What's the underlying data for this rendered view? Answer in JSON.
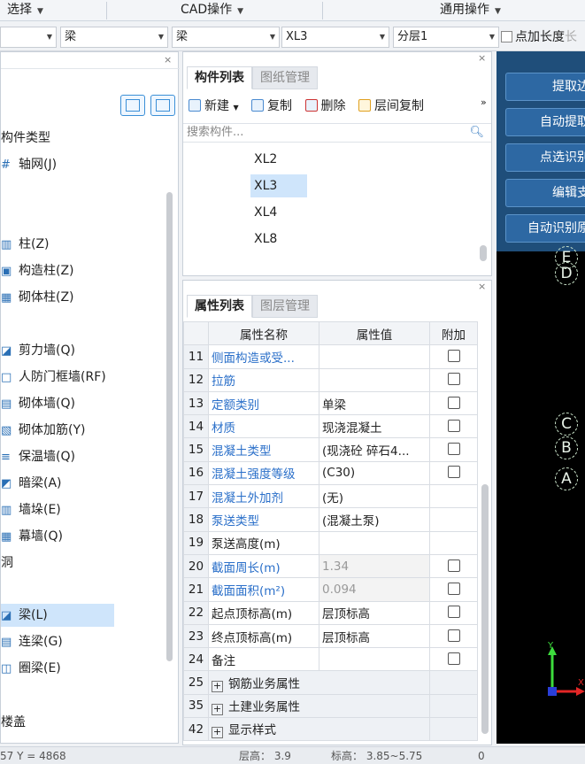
{
  "menu": {
    "items": [
      "选择",
      "CAD操作",
      "通用操作"
    ]
  },
  "combos": {
    "c1": "",
    "c2": "梁",
    "c3": "梁",
    "c4": "XL3",
    "c5": "分层1"
  },
  "checkbox": {
    "label": "点加长度",
    "faded": "长"
  },
  "left": {
    "section_title": "构件类型",
    "items": [
      {
        "icon": "#",
        "label": "轴网(J)"
      },
      {
        "icon": "▥",
        "label": "柱(Z)"
      },
      {
        "icon": "▣",
        "label": "构造柱(Z)"
      },
      {
        "icon": "▦",
        "label": "砌体柱(Z)"
      },
      {
        "icon": "◪",
        "label": "剪力墙(Q)"
      },
      {
        "icon": "□",
        "label": "人防门框墙(RF)"
      },
      {
        "icon": "▤",
        "label": "砌体墙(Q)"
      },
      {
        "icon": "▧",
        "label": "砌体加筋(Y)"
      },
      {
        "icon": "≡",
        "label": "保温墙(Q)"
      },
      {
        "icon": "◩",
        "label": "暗梁(A)"
      },
      {
        "icon": "▥",
        "label": "墙垛(E)"
      },
      {
        "icon": "▦",
        "label": "幕墙(Q)"
      },
      {
        "icon": "◪",
        "label": "梁(L)"
      },
      {
        "icon": "▤",
        "label": "连梁(G)"
      },
      {
        "icon": "◫",
        "label": "圈梁(E)"
      }
    ],
    "group_hole": "洞",
    "group_slab": "楼盖"
  },
  "component_panel": {
    "tabs": [
      "构件列表",
      "图纸管理"
    ],
    "tools": [
      "新建",
      "复制",
      "删除",
      "层间复制"
    ],
    "more": "»",
    "search_placeholder": "搜索构件...",
    "list": [
      "XL2",
      "XL3",
      "XL4",
      "XL8"
    ],
    "selected": "XL3"
  },
  "property_panel": {
    "tabs": [
      "属性列表",
      "图层管理"
    ],
    "headers": [
      "属性名称",
      "属性值",
      "附加"
    ],
    "rows": [
      {
        "n": "11",
        "name": "侧面构造或受...",
        "value": "",
        "cb": true
      },
      {
        "n": "12",
        "name": "拉筋",
        "value": "",
        "cb": true
      },
      {
        "n": "13",
        "name": "定额类别",
        "value": "单梁",
        "cb": true
      },
      {
        "n": "14",
        "name": "材质",
        "value": "现浇混凝土",
        "cb": true
      },
      {
        "n": "15",
        "name": "混凝土类型",
        "value": "(现浇砼 碎石4...",
        "cb": true
      },
      {
        "n": "16",
        "name": "混凝土强度等级",
        "value": "(C30)",
        "cb": true
      },
      {
        "n": "17",
        "name": "混凝土外加剂",
        "value": "(无)",
        "cb": false
      },
      {
        "n": "18",
        "name": "泵送类型",
        "value": "(混凝土泵)",
        "cb": false
      },
      {
        "n": "19",
        "name": "泵送高度(m)",
        "value": "",
        "cb": false
      },
      {
        "n": "20",
        "name": "截面周长(m)",
        "value": "1.34",
        "cb": true
      },
      {
        "n": "21",
        "name": "截面面积(m²)",
        "value": "0.094",
        "cb": true
      },
      {
        "n": "22",
        "name": "起点顶标高(m)",
        "value": "层顶标高",
        "cb": true
      },
      {
        "n": "23",
        "name": "终点顶标高(m)",
        "value": "层顶标高",
        "cb": true
      },
      {
        "n": "24",
        "name": "备注",
        "value": "",
        "cb": true
      },
      {
        "n": "25",
        "name": "钢筋业务属性",
        "value": "",
        "cb": false,
        "group": true
      },
      {
        "n": "35",
        "name": "土建业务属性",
        "value": "",
        "cb": false,
        "group": true
      },
      {
        "n": "42",
        "name": "显示样式",
        "value": "",
        "cb": false,
        "group": true
      }
    ]
  },
  "right_buttons": [
    "提取边",
    "自动提取",
    "点选识别",
    "编辑支",
    "自动识别原"
  ],
  "axis_labels": [
    "E",
    "D",
    "C",
    "B",
    "A"
  ],
  "coord_axes": {
    "x": "X",
    "y": "Y"
  },
  "status": {
    "coords": "57 Y = 4868",
    "floor": "层高：  3.9",
    "elev": "标高：  3.85~5.75",
    "extra": "0"
  }
}
